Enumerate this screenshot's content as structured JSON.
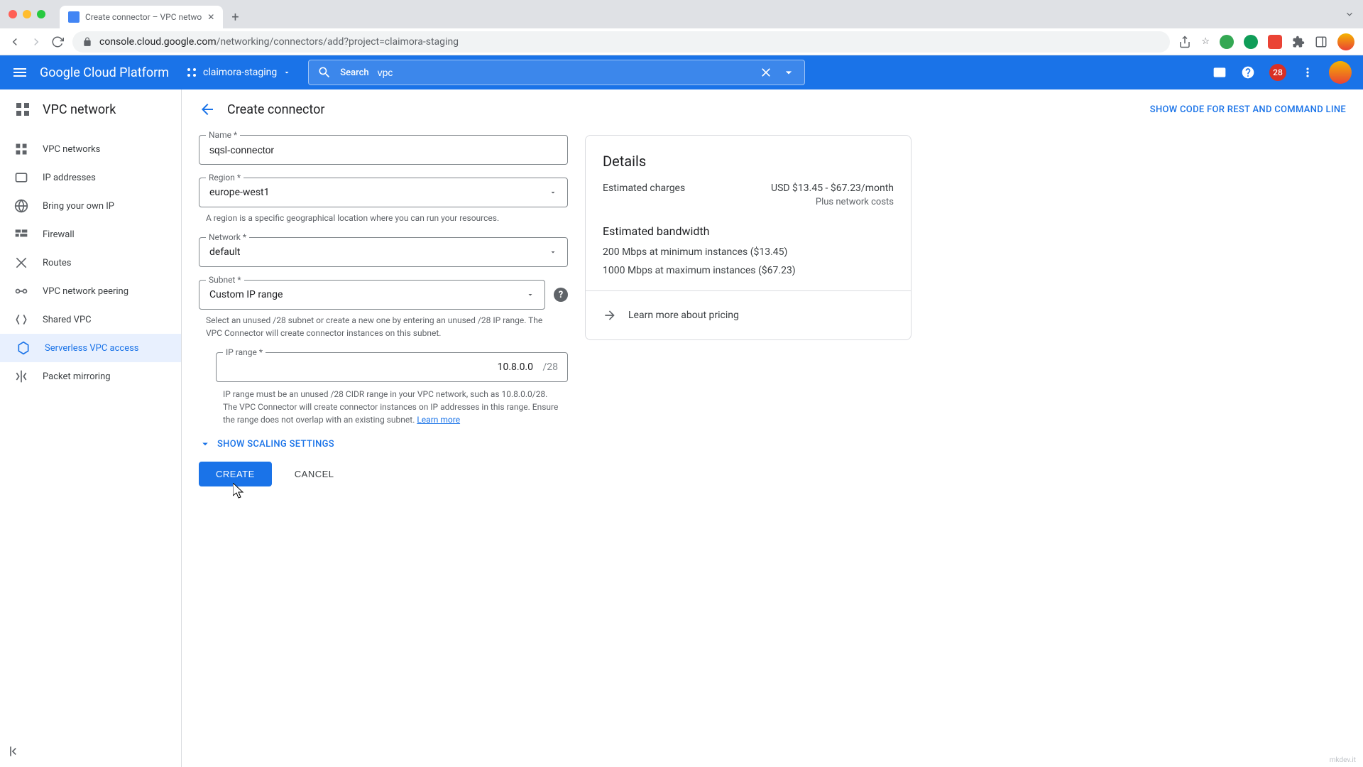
{
  "browser": {
    "tab_title": "Create connector – VPC netwo",
    "url_domain": "console.cloud.google.com",
    "url_path": "/networking/connectors/add?project=claimora-staging"
  },
  "header": {
    "logo": "Google Cloud Platform",
    "project": "claimora-staging",
    "search_label": "Search",
    "search_value": "vpc",
    "notification_count": "28"
  },
  "sidebar": {
    "title": "VPC network",
    "items": [
      {
        "label": "VPC networks"
      },
      {
        "label": "IP addresses"
      },
      {
        "label": "Bring your own IP"
      },
      {
        "label": "Firewall"
      },
      {
        "label": "Routes"
      },
      {
        "label": "VPC network peering"
      },
      {
        "label": "Shared VPC"
      },
      {
        "label": "Serverless VPC access"
      },
      {
        "label": "Packet mirroring"
      }
    ]
  },
  "page": {
    "title": "Create connector",
    "show_code": "SHOW CODE FOR REST AND COMMAND LINE"
  },
  "form": {
    "name": {
      "label": "Name *",
      "value": "sqsl-connector"
    },
    "region": {
      "label": "Region *",
      "value": "europe-west1",
      "helper": "A region is a specific geographical location where you can run your resources."
    },
    "network": {
      "label": "Network *",
      "value": "default"
    },
    "subnet": {
      "label": "Subnet *",
      "value": "Custom IP range",
      "helper": "Select an unused /28 subnet or create a new one by entering an unused /28 IP range. The VPC Connector will create connector instances on this subnet."
    },
    "ip_range": {
      "label": "IP range *",
      "value": "10.8.0.0",
      "suffix": "/28",
      "helper": "IP range must be an unused /28 CIDR range in your VPC network, such as 10.8.0.0/28. The VPC Connector will create connector instances on IP addresses in this range. Ensure the range does not overlap with an existing subnet. ",
      "learn_more": "Learn more"
    },
    "scaling_toggle": "SHOW SCALING SETTINGS",
    "create": "CREATE",
    "cancel": "CANCEL"
  },
  "details": {
    "title": "Details",
    "charges_label": "Estimated charges",
    "charges_value": "USD $13.45 - $67.23/month",
    "charges_sub": "Plus network costs",
    "bandwidth_title": "Estimated bandwidth",
    "bandwidth_min": "200 Mbps at minimum instances ($13.45)",
    "bandwidth_max": "1000 Mbps at maximum instances ($67.23)",
    "learn_more": "Learn more about pricing"
  },
  "watermark": "mkdev.it"
}
